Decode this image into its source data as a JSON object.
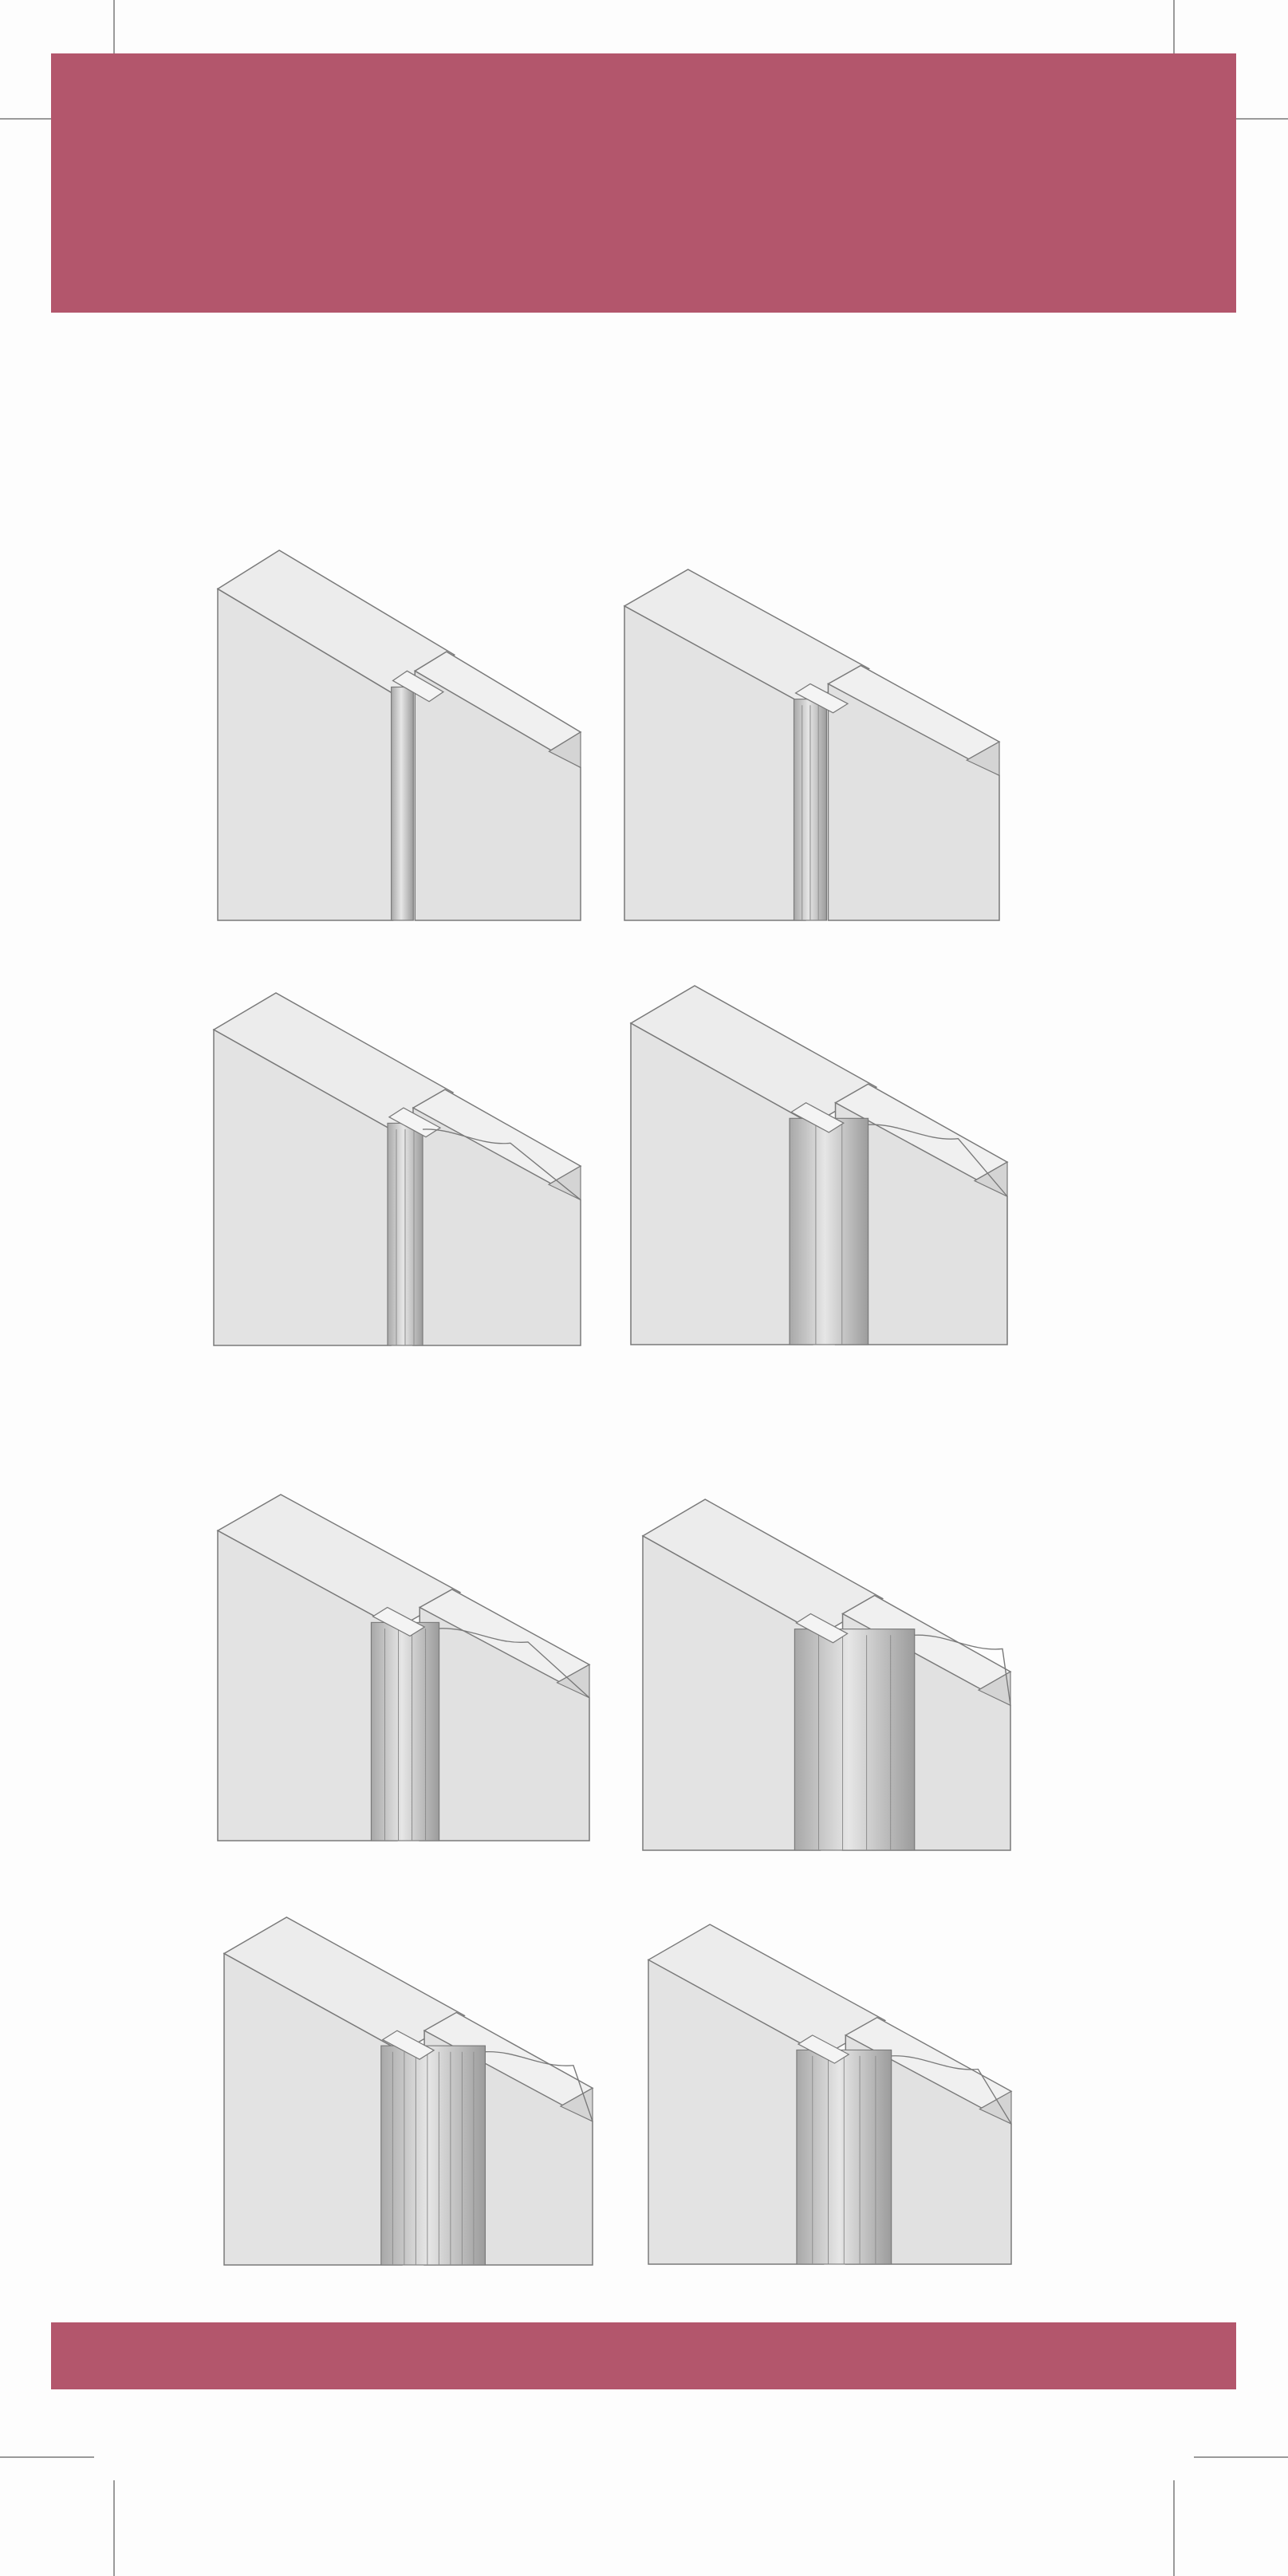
{
  "colors": {
    "band": "#b3566c",
    "page": "#fdfdfd",
    "crop_mark": "#9a9a9a"
  },
  "illustration": {
    "subject": "moulded-panel-edge-profiles",
    "groups": [
      {
        "profiles": [
          "plain-square-groove",
          "double-bead-groove",
          "bead-with-cove-tongue",
          "large-round-bead-tongue"
        ]
      },
      {
        "profiles": [
          "cove-bead-long-ogee",
          "bead-fillet-ogee-step",
          "multi-reed-ogee",
          "round-bead-reed-ogee-tongue"
        ]
      }
    ]
  }
}
